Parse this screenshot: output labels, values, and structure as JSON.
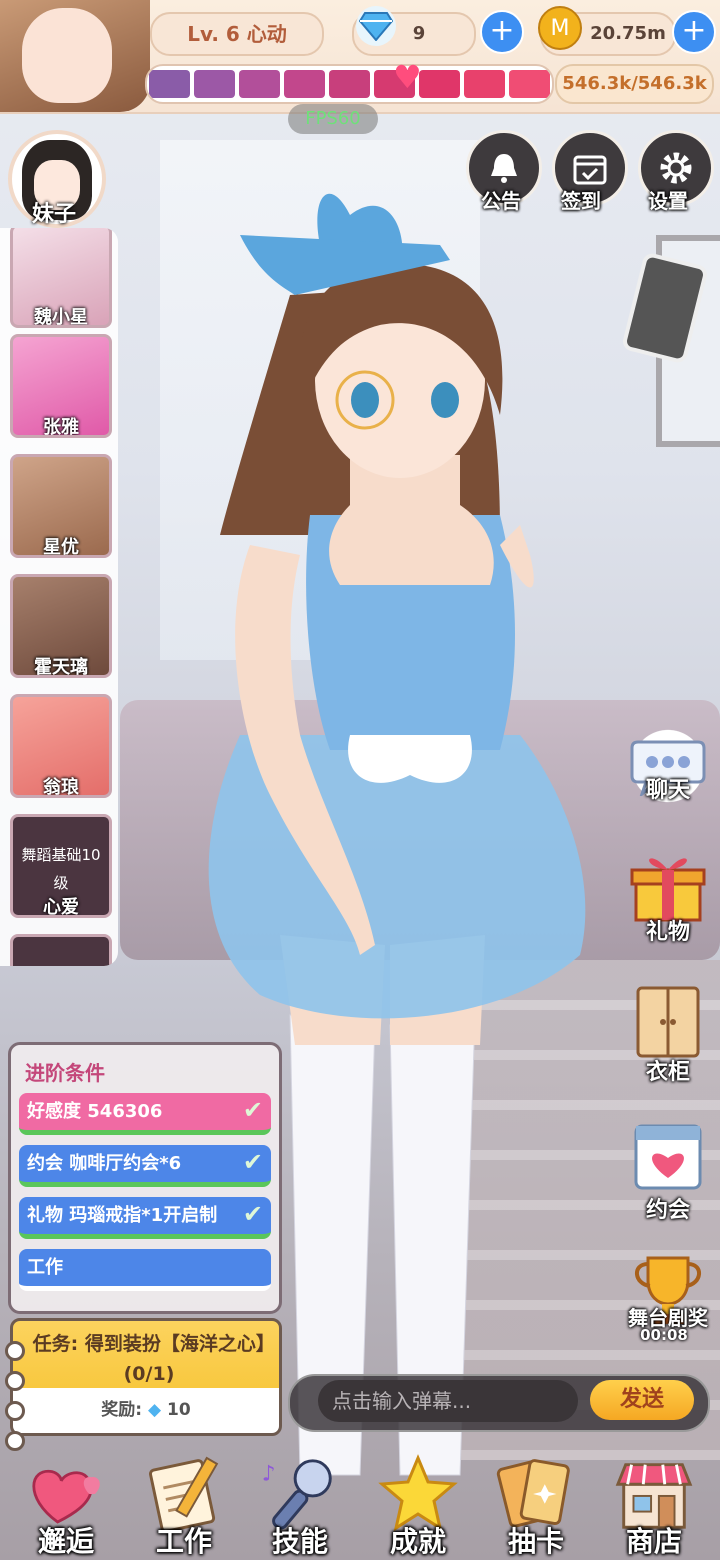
{
  "header": {
    "level_text": "Lv. 6 心动",
    "diamonds": "9",
    "gold": "20.75m",
    "affection_progress": "546.3k/546.3k",
    "fps": "FPS60"
  },
  "top_buttons": [
    {
      "label": "公告",
      "icon": "bell-icon"
    },
    {
      "label": "签到",
      "icon": "calendar-check-icon"
    },
    {
      "label": "设置",
      "icon": "gear-icon"
    }
  ],
  "character_list": {
    "current": "妹子",
    "items": [
      {
        "name": "魏小星",
        "color": "#d9a3b8"
      },
      {
        "name": "张雅",
        "color": "#e05aa8"
      },
      {
        "name": "星优",
        "color": "#9b6a4e"
      },
      {
        "name": "霍天璃",
        "color": "#6e4a3c"
      },
      {
        "name": "翁琅",
        "color": "#e46e6a"
      }
    ],
    "locked": {
      "requirement": "舞蹈基础10级",
      "name": "心爱"
    }
  },
  "side_buttons": [
    {
      "label": "聊天",
      "icon": "chat-bubble-icon"
    },
    {
      "label": "礼物",
      "icon": "gift-icon"
    },
    {
      "label": "衣柜",
      "icon": "wardrobe-icon"
    },
    {
      "label": "约会",
      "icon": "date-calendar-icon"
    },
    {
      "label": "舞台剧奖",
      "icon": "trophy-icon"
    }
  ],
  "stage_timer": "00:08",
  "advancement": {
    "title": "进阶条件",
    "conditions": [
      {
        "text": "好感度 546306",
        "color": "#f06aa3",
        "done": true
      },
      {
        "text": "约会 咖啡厅约会*6",
        "color": "#4d86e8",
        "done": true
      },
      {
        "text": "礼物 玛瑙戒指*1开启制",
        "color": "#4d86e8",
        "done": true
      },
      {
        "text": "工作",
        "color": "#4d86e8",
        "done": false
      }
    ]
  },
  "task": {
    "text": "任务: 得到装扮【海洋之心】(0/1)",
    "reward_label": "奖励:",
    "reward_value": "10"
  },
  "chat": {
    "placeholder": "点击输入弹幕...",
    "send_label": "发送"
  },
  "bottom_nav": [
    {
      "label": "邂逅",
      "icon": "hearts-icon"
    },
    {
      "label": "工作",
      "icon": "notebook-pencil-icon"
    },
    {
      "label": "技能",
      "icon": "microphone-icon"
    },
    {
      "label": "成就",
      "icon": "star-icon"
    },
    {
      "label": "抽卡",
      "icon": "cards-icon"
    },
    {
      "label": "商店",
      "icon": "shop-icon"
    }
  ],
  "colors": {
    "diamond": "#4fb3f0",
    "gold": "#f2b21c",
    "plus": "#3d8ff2",
    "heart": "#ff4d7d"
  }
}
